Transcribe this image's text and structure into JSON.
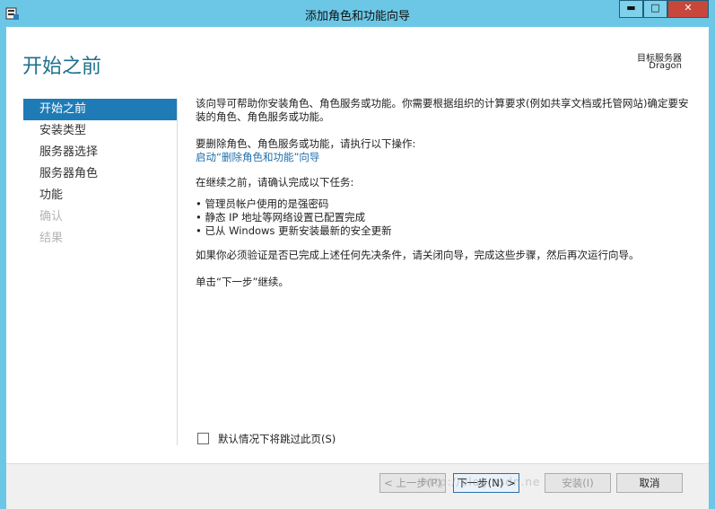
{
  "window": {
    "title": "添加角色和功能向导",
    "controls": {
      "minimize": "▬",
      "maximize": "□",
      "close": "✕"
    }
  },
  "header": {
    "page_title": "开始之前",
    "destination_label": "目标服务器",
    "destination_server": "Dragon"
  },
  "nav": {
    "items": [
      {
        "label": "开始之前",
        "state": "active"
      },
      {
        "label": "安装类型",
        "state": "normal"
      },
      {
        "label": "服务器选择",
        "state": "normal"
      },
      {
        "label": "服务器角色",
        "state": "normal"
      },
      {
        "label": "功能",
        "state": "normal"
      },
      {
        "label": "确认",
        "state": "disabled"
      },
      {
        "label": "结果",
        "state": "disabled"
      }
    ]
  },
  "content": {
    "intro": "该向导可帮助你安装角色、角色服务或功能。你需要根据组织的计算要求(例如共享文档或托管网站)确定要安装的角色、角色服务或功能。",
    "remove_prompt": "要删除角色、角色服务或功能，请执行以下操作:",
    "remove_link": "启动“删除角色和功能”向导",
    "before_continue": "在继续之前，请确认完成以下任务:",
    "tasks": [
      "• 管理员帐户使用的是强密码",
      "• 静态 IP 地址等网络设置已配置完成",
      "• 已从 Windows 更新安装最新的安全更新"
    ],
    "verify_note": "如果你必须验证是否已完成上述任何先决条件，请关闭向导，完成这些步骤，然后再次运行向导。",
    "continue_note": "单击“下一步”继续。"
  },
  "skip": {
    "label": "默认情况下将跳过此页(S)"
  },
  "footer": {
    "prev": "< 上一步(P)",
    "next": "下一步(N) >",
    "install": "安装(I)",
    "cancel": "取消"
  },
  "watermark": "http://blog.csdn.ne"
}
